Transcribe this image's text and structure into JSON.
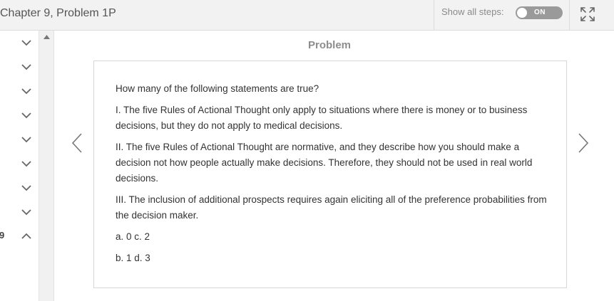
{
  "header": {
    "title": "Chapter 9, Problem 1P",
    "show_steps_label": "Show all steps:",
    "toggle_label": "ON"
  },
  "sidebar": {
    "chapter_number": "9"
  },
  "problem": {
    "heading": "Problem",
    "question": "How many of the following statements are true?",
    "statements": [
      "I. The five Rules of Actional Thought only apply to situations where there is money or to business decisions, but they do not apply to medical decisions.",
      "II. The five Rules of Actional Thought are normative, and they describe how you should make a decision not how people actually make decisions. Therefore, they should not be used in real world decisions.",
      "III. The inclusion of additional prospects requires again eliciting all of the preference probabilities from the decision maker."
    ],
    "options": [
      "a. 0 c. 2",
      "b. 1 d. 3"
    ]
  }
}
